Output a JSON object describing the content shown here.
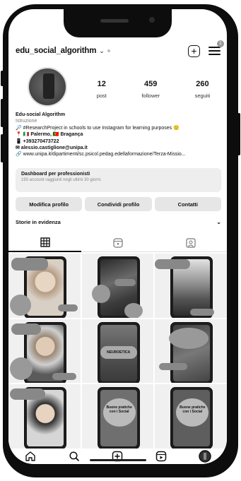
{
  "header": {
    "username": "edu_social_algorithm",
    "chevron": "⌄",
    "notification_badge": "1",
    "icons": [
      "plus-square-icon",
      "hamburger-menu-icon"
    ]
  },
  "profile": {
    "stats": [
      {
        "value": "12",
        "label": "post"
      },
      {
        "value": "459",
        "label": "follower"
      },
      {
        "value": "260",
        "label": "seguiti"
      }
    ],
    "name": "Edu-social Algorithm",
    "category": "Istruzione",
    "bio_lines": [
      "🔎 #ResearchProject in schools to use Instagram for learning purposes 🙂",
      "📍 🇮🇹 Palermo, 🇵🇹 Bragança",
      "📱 +393270473722",
      "✉ alessio.castiglione@unipa.it",
      "🔗 www.unipa.it/dipartimenti/sc.psicol.pedag.edellaformazione/Terza-Missio..."
    ]
  },
  "dashboard": {
    "title": "Dashboard per professionisti",
    "subtitle": "193 account raggiunti negli ultimi 30 giorni."
  },
  "actions": {
    "edit": "Modifica profilo",
    "share": "Condividi profilo",
    "contacts": "Contatti"
  },
  "highlights": {
    "label": "Storie in evidenza",
    "chevron": "⌄"
  },
  "tabs": [
    "grid-icon",
    "reels-icon",
    "tagged-icon"
  ],
  "posts": [
    {
      "overlay": ""
    },
    {
      "overlay": ""
    },
    {
      "overlay": ""
    },
    {
      "overlay": ""
    },
    {
      "overlay": "NEUROETICA"
    },
    {
      "overlay": ""
    },
    {
      "overlay": ""
    },
    {
      "overlay": "Buone pratiche con i Social"
    },
    {
      "overlay": "Buone pratiche con i Social"
    }
  ],
  "bottom_nav": [
    "home-icon",
    "search-icon",
    "create-icon",
    "reels-icon",
    "profile-icon"
  ]
}
